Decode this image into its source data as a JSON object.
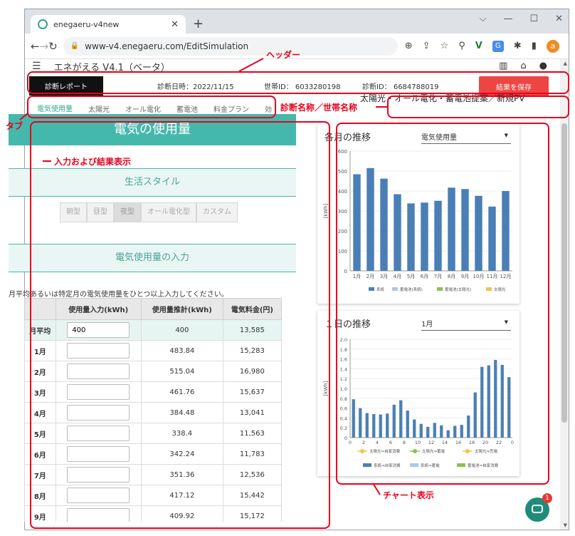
{
  "browser": {
    "tab_title": "enegaeru-v4new",
    "url": "www-v4.enegaeru.com/EditSimulation",
    "avatar_letter": "a"
  },
  "app": {
    "title": "エネがえる V4.1（ベータ）"
  },
  "report_bar": {
    "report_button": "診断レポート",
    "date": "診断日時：2022/11/15",
    "household_id": "世帯ID： 6033280198",
    "diagnosis_id": "診断ID： 6684788019",
    "save_button": "結果を保存"
  },
  "tabs": [
    "電気使用量",
    "太陽光",
    "オール電化",
    "蓄電池",
    "料金プラン",
    "効"
  ],
  "diagnosis_name": "太陽光・オール電化・蓄電池提案／新規PV",
  "left_panel": {
    "title": "電気の使用量",
    "section_lifestyle": "生活スタイル",
    "style_buttons": [
      "朝型",
      "昼型",
      "夜型",
      "オール電化型",
      "カスタム"
    ],
    "selected_style": "夜型",
    "section_input": "電気使用量の入力",
    "instruction": "月平均あるいは特定月の電気使用量をひとつ以上入力してください。",
    "table": {
      "headers": [
        "",
        "使用量入力(kWh)",
        "使用量推計(kWh)",
        "電気料金(円)"
      ],
      "rows": [
        {
          "month": "月平均",
          "input": "400",
          "estimate": "400",
          "fee": "13,585"
        },
        {
          "month": "1月",
          "input": "",
          "estimate": "483.84",
          "fee": "15,283"
        },
        {
          "month": "2月",
          "input": "",
          "estimate": "515.04",
          "fee": "16,980"
        },
        {
          "month": "3月",
          "input": "",
          "estimate": "461.76",
          "fee": "15,637"
        },
        {
          "month": "4月",
          "input": "",
          "estimate": "384.48",
          "fee": "13,041"
        },
        {
          "month": "5月",
          "input": "",
          "estimate": "338.4",
          "fee": "11,563"
        },
        {
          "month": "6月",
          "input": "",
          "estimate": "342.24",
          "fee": "11,783"
        },
        {
          "month": "7月",
          "input": "",
          "estimate": "351.36",
          "fee": "12,536"
        },
        {
          "month": "8月",
          "input": "",
          "estimate": "417.12",
          "fee": "15,442"
        },
        {
          "month": "9月",
          "input": "",
          "estimate": "409.92",
          "fee": "15,172"
        }
      ]
    }
  },
  "monthly_chart": {
    "title": "各月の推移",
    "selector": "電気使用量",
    "ylabel": "[kWh]",
    "legend": [
      "系統",
      "蓄電池(系統)",
      "蓄電池(太陽光)",
      "太陽光"
    ],
    "legend_colors": [
      "#4a7fb5",
      "#a9c8ec",
      "#8bc34a",
      "#f5c24e"
    ],
    "ylim": [
      0,
      600
    ],
    "yticks": [
      0,
      100,
      200,
      300,
      400,
      500,
      600
    ],
    "categories": [
      "1月",
      "2月",
      "3月",
      "4月",
      "5月",
      "6月",
      "7月",
      "8月",
      "9月",
      "10月",
      "11月",
      "12月"
    ],
    "values": [
      484,
      515,
      462,
      384,
      338,
      342,
      351,
      417,
      410,
      376,
      322,
      400
    ]
  },
  "daily_chart": {
    "title": "１日の推移",
    "selector": "1月",
    "ylabel": "[kWh]",
    "ylim": [
      0,
      2.0
    ],
    "yticks": [
      "0",
      "0.2",
      "0.4",
      "0.6",
      "0.8",
      "1.0",
      "1.2",
      "1.4",
      "1.6",
      "1.8",
      "2.0"
    ],
    "xticks": [
      "0",
      "2",
      "4",
      "6",
      "8",
      "10",
      "12",
      "14",
      "16",
      "18",
      "20",
      "22",
      "0"
    ],
    "values": [
      0.78,
      0.6,
      0.5,
      0.48,
      0.47,
      0.49,
      0.67,
      0.76,
      0.55,
      0.37,
      0.28,
      0.22,
      0.3,
      0.25,
      0.15,
      0.24,
      0.26,
      0.45,
      0.92,
      1.44,
      1.47,
      1.58,
      1.48,
      1.23
    ],
    "legend_line": [
      "太陽光⇒自家消費",
      "太陽光⇒蓄電",
      "太陽光⇒売電"
    ],
    "legend_bar": [
      "系統⇒自家消費",
      "系統⇒蓄電",
      "蓄電池⇒自家消費"
    ],
    "legend_bar_colors": [
      "#4a7fb5",
      "#a9c8ec",
      "#8bc34a"
    ]
  },
  "annotations": {
    "header": "ヘッダー",
    "tab": "タブ",
    "name": "診断名称／世帯名称",
    "input": "入力および結果表示",
    "chart": "チャート表示"
  },
  "chat_badge": "1",
  "colors": {
    "accent": "#45b8ac",
    "annotation": "#e8001c",
    "save": "#ef4444"
  }
}
